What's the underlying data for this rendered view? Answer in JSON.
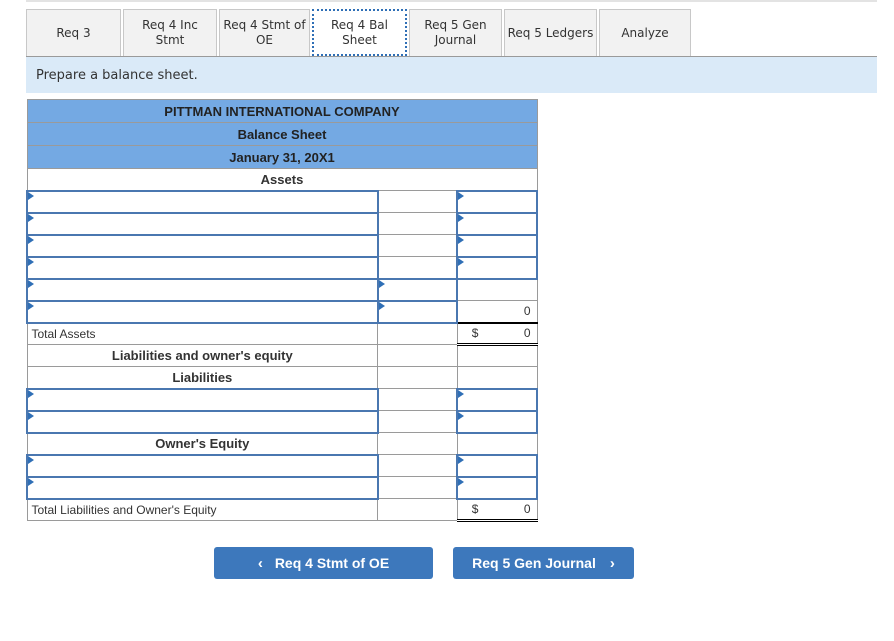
{
  "tabs": [
    {
      "label": "Req 3",
      "active": false
    },
    {
      "label": "Req 4 Inc Stmt",
      "active": false
    },
    {
      "label": "Req 4 Stmt of OE",
      "active": false
    },
    {
      "label": "Req 4 Bal Sheet",
      "active": true
    },
    {
      "label": "Req 5 Gen Journal",
      "active": false
    },
    {
      "label": "Req 5 Ledgers",
      "active": false
    },
    {
      "label": "Analyze",
      "active": false
    }
  ],
  "instruction": "Prepare a balance sheet.",
  "balance_sheet": {
    "company": "PITTMAN INTERNATIONAL COMPANY",
    "title": "Balance Sheet",
    "date": "January 31, 20X1",
    "assets_heading": "Assets",
    "asset_subtotal": "0",
    "total_assets_label": "Total Assets",
    "total_assets_currency": "$",
    "total_assets_value": "0",
    "liab_oe_heading": "Liabilities and owner's equity",
    "liabilities_heading": "Liabilities",
    "oe_heading": "Owner's Equity",
    "total_liab_oe_label": "Total Liabilities and Owner's Equity",
    "total_liab_oe_currency": "$",
    "total_liab_oe_value": "0"
  },
  "nav": {
    "prev_label": "Req 4 Stmt of OE",
    "next_label": "Req 5 Gen Journal"
  }
}
